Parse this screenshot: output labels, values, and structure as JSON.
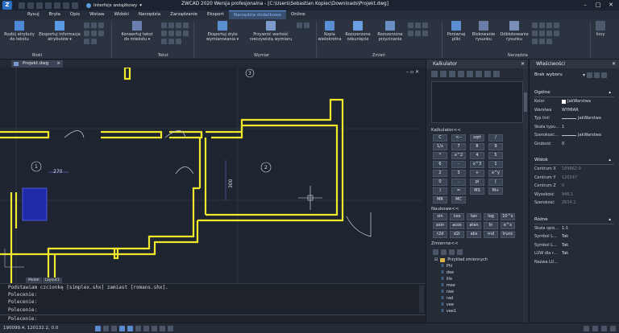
{
  "titlebar": {
    "workspace": "Interfejs wstążkowy",
    "title": "ZWCAD 2020 Wersja profesjonalna - [C:\\Users\\Sebastian Kopiec\\Downloads\\Projekt.dwg]"
  },
  "menu": [
    "Rysuj",
    "Bryła",
    "Opis",
    "Wstaw",
    "Widoki",
    "Narzędzia",
    "Zarządzanie",
    "Eksport",
    "Narzędzia dodatkowe",
    "Online"
  ],
  "ribbon": {
    "buttons": [
      {
        "label1": "Rozbij atrybuty",
        "label2": "do tekstu"
      },
      {
        "label1": "Eksportuj informacje",
        "label2": "atrybutów ▾"
      },
      {
        "label1": "Konwertuj tekst",
        "label2": "do mtekstu ▾"
      },
      {
        "label1": "Eksportuj style",
        "label2": "wymiarowania ▾"
      },
      {
        "label1": "Przywróć wartość",
        "label2": "rzeczywistą wymiaru"
      },
      {
        "label1": "Kopia",
        "label2": "wielokrotna"
      },
      {
        "label1": "Rozszerzone",
        "label2": "odsunięcie"
      },
      {
        "label1": "Rozszerzone",
        "label2": "przycinanie"
      },
      {
        "label1": "Porównaj",
        "label2": "pliki"
      },
      {
        "label1": "Blokowanie",
        "label2": "rysunku"
      },
      {
        "label1": "Odblokowanie",
        "label2": "rysunku"
      },
      {
        "label1": "Inny",
        "label2": ""
      }
    ],
    "groups": [
      "Bloki",
      "Tekst",
      "Wymiar",
      "Zmień",
      "Narzędzia"
    ]
  },
  "doc_tab": "Projekt.dwg",
  "canvas": {
    "dim_270": "270",
    "dim_300": "300",
    "bubble_1": "1",
    "bubble_2": "2",
    "bubble_3": "3"
  },
  "model_tabs": [
    "Model",
    "Layout1"
  ],
  "command_lines": [
    "Podstawiam czcionkę [simplex.shx] zamiast [romans.shx].",
    "Polecenie:",
    "Polecenie:",
    "Polecenie:"
  ],
  "prompt": "Polecenie:",
  "status": {
    "coords": "190099.4, 120132.2, 0.0"
  },
  "calculator": {
    "title": "Kalkulator",
    "section_calc": "Kalkulator<<",
    "keys": [
      "C",
      "<--",
      "sqrt",
      "/",
      "1/x",
      "7",
      "8",
      "9",
      "*",
      "x^2",
      "4",
      "5",
      "6",
      "-",
      "x^3",
      "1",
      "2",
      "3",
      "+",
      "x^y",
      "0",
      ".",
      "pi",
      "(",
      ")",
      "=",
      "MS",
      "M+",
      "MR",
      "MC"
    ],
    "section_sci": "Naukowe<<",
    "sci_keys": [
      "sin",
      "cos",
      "tan",
      "log",
      "10^x",
      "asin",
      "acos",
      "atan",
      "ln",
      "e^x",
      "r2d",
      "d2r",
      "abs",
      "rnd",
      "trunc"
    ],
    "section_vars": "Zmienne<<",
    "var_folder": "Przykład zmiennych",
    "vars": [
      "Phi",
      "dee",
      "ille",
      "mee",
      "nee",
      "rad",
      "vee",
      "vee1"
    ]
  },
  "properties": {
    "title": "Właściwości",
    "selection": "Brak wyboru",
    "general_header": "Ogólne",
    "general": [
      {
        "k": "Kolor",
        "v": "JakWarstwa"
      },
      {
        "k": "Warstwa",
        "v": "WYMIAR"
      },
      {
        "k": "Typ linii",
        "v": "JakWarstwa"
      },
      {
        "k": "Skala typu...",
        "v": "1"
      },
      {
        "k": "Szerokość...",
        "v": "JakWarstwa"
      },
      {
        "k": "Grubość",
        "v": "0"
      }
    ],
    "view_header": "Widok",
    "view": [
      {
        "k": "Centrum X",
        "v": "189662.9"
      },
      {
        "k": "Centrum Y",
        "v": "120247"
      },
      {
        "k": "Centrum Z",
        "v": "0"
      },
      {
        "k": "Wysokość",
        "v": "946.1"
      },
      {
        "k": "Szerokość",
        "v": "2634.2"
      }
    ],
    "misc_header": "Różne",
    "misc": [
      {
        "k": "Skala opis...",
        "v": "1:1"
      },
      {
        "k": "Symbol L...",
        "v": "Tak"
      },
      {
        "k": "Symbol L...",
        "v": "Tak"
      },
      {
        "k": "LUW dla r...",
        "v": "Tak"
      },
      {
        "k": "Nazwa LU...",
        "v": ""
      }
    ]
  },
  "colors": {
    "walls": "#f0e82a",
    "dims": "#7a82ff",
    "background": "#1e2531"
  }
}
